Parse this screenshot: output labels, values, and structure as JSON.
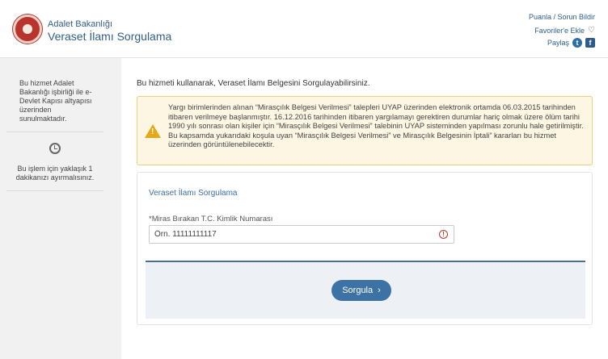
{
  "header": {
    "org_name": "Adalet Bakanlığı",
    "service_title": "Veraset İlamı Sorgulama",
    "rate_link": "Puanla / Sorun Bildir",
    "favorite_link": "Favoriler'e Ekle",
    "share_label": "Paylaş",
    "favorite_icon": "heart-icon",
    "share_icons": [
      "twitter-icon",
      "facebook-icon"
    ]
  },
  "sidebar": {
    "info_text": "Bu hizmet Adalet Bakanlığı işbirliği ile e-Devlet Kapısı altyapısı üzerinden sunulmaktadır.",
    "clock_icon": "clock-icon",
    "duration_text": "Bu işlem için yaklaşık 1 dakikanızı ayırmalısınız."
  },
  "main": {
    "intro": "Bu hizmeti kullanarak, Veraset İlamı Belgesini Sorgulayabilirsiniz.",
    "warning_icon": "warning-icon",
    "warning": "Yargı birimlerinden alınan “Mirasçılık Belgesi Verilmesi” talepleri UYAP üzerinden elektronik ortamda 06.03.2015 tarihinden itibaren verilmeye başlanmıştır. 16.12.2016 tarihinden itibaren yargılamayı gerektiren durumlar hariç olmak üzere ölüm tarihi 1990 yılı sonrası olan kişiler için “Mirasçılık Belgesi Verilmesi” talebinin UYAP sisteminden yapılması zorunlu hale getirilmiştir. Bu kapsamda yukarıdaki koşula uyan “Mirasçılık Belgesi Verilmesi” ve Mirasçılık Belgesinin İptali” kararları bu hizmet üzerinden görüntülenebilecektir.",
    "form": {
      "title": "Veraset İlamı Sorgulama",
      "field_label": "*Miras Bırakan T.C. Kimlik Numarası",
      "field_value": "",
      "field_placeholder": "Örn. 11111111117",
      "error_icon": "exclamation-circle-icon",
      "submit_label": "Sorgula",
      "submit_icon": "chevron-right-icon"
    }
  },
  "colors": {
    "brand_blue": "#3d72a4",
    "warning_bg": "#fdf6e3",
    "warning_icon": "#e6a817",
    "logo_red": "#b8342c"
  }
}
